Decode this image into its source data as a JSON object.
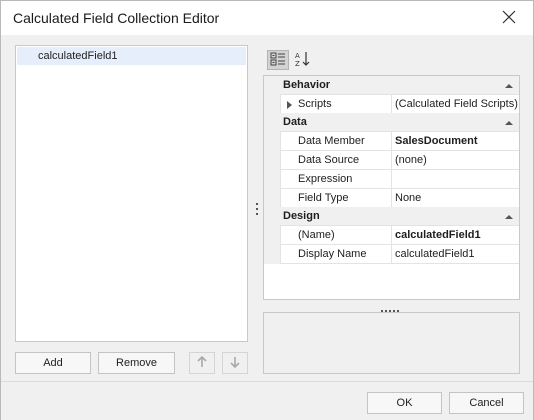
{
  "window": {
    "title": "Calculated Field Collection Editor"
  },
  "list": {
    "items": [
      "calculatedField1"
    ]
  },
  "buttons": {
    "add": "Add",
    "remove": "Remove",
    "ok": "OK",
    "cancel": "Cancel"
  },
  "icons": {
    "close": "close-icon",
    "categorized": "categorized-icon",
    "alphabetical": "sort-alphabetical-icon",
    "move_up": "arrow-up-icon",
    "move_down": "arrow-down-icon"
  },
  "property_grid": {
    "categories": [
      {
        "name": "Behavior",
        "rows": [
          {
            "name": "Scripts",
            "value": "(Calculated Field Scripts)",
            "bold": false,
            "expandable": true
          }
        ]
      },
      {
        "name": "Data",
        "rows": [
          {
            "name": "Data Member",
            "value": "SalesDocument",
            "bold": true
          },
          {
            "name": "Data Source",
            "value": "(none)",
            "bold": false
          },
          {
            "name": "Expression",
            "value": "",
            "bold": false
          },
          {
            "name": "Field Type",
            "value": "None",
            "bold": false
          }
        ]
      },
      {
        "name": "Design",
        "rows": [
          {
            "name": "(Name)",
            "value": "calculatedField1",
            "bold": true
          },
          {
            "name": "Display Name",
            "value": "calculatedField1",
            "bold": false
          }
        ]
      }
    ]
  },
  "colors": {
    "selection": "#e7eefb",
    "background": "#f0f0f0",
    "border": "#c9c9c9"
  }
}
